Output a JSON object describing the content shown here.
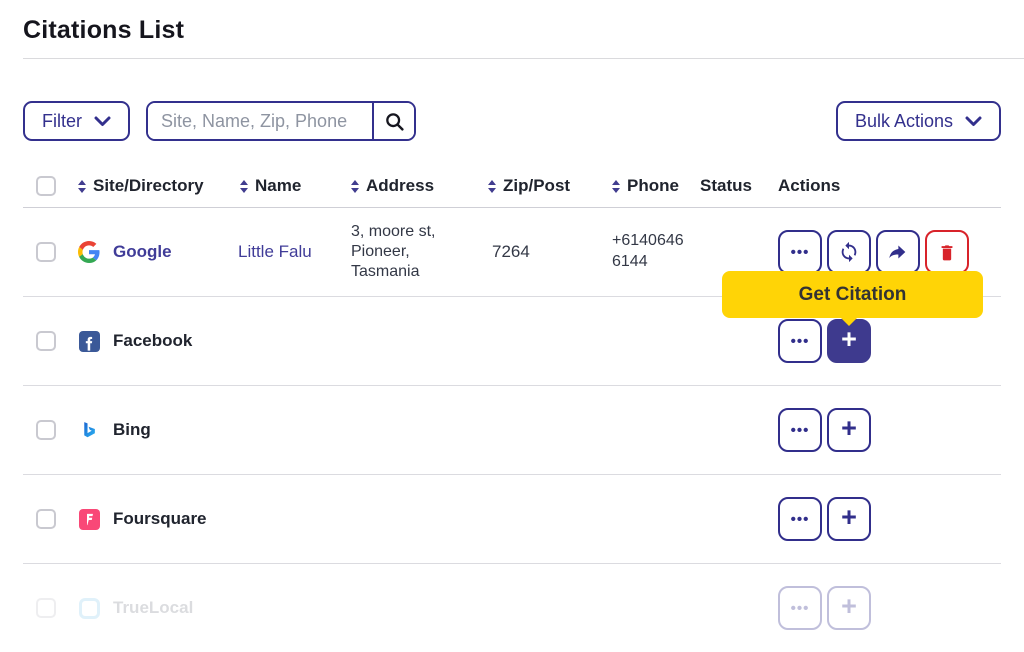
{
  "page": {
    "title": "Citations List"
  },
  "toolbar": {
    "filter_label": "Filter",
    "search_placeholder": "Site, Name, Zip, Phone",
    "bulk_actions_label": "Bulk Actions"
  },
  "table": {
    "headers": {
      "site": "Site/Directory",
      "name": "Name",
      "address": "Address",
      "zip": "Zip/Post",
      "phone": "Phone",
      "status": "Status",
      "actions": "Actions"
    },
    "rows": [
      {
        "site": "Google",
        "icon": "google-logo",
        "name": "Little Falu",
        "address": "3, moore st, Pioneer, Tasmania",
        "zip": "7264",
        "phone_line1": "+6140646",
        "phone_line2": "6144"
      },
      {
        "site": "Facebook",
        "icon": "facebook-logo"
      },
      {
        "site": "Bing",
        "icon": "bing-logo"
      },
      {
        "site": "Foursquare",
        "icon": "foursquare-logo"
      },
      {
        "site": "TrueLocal",
        "icon": "truelocal-logo"
      }
    ]
  },
  "tooltip": {
    "label": "Get Citation"
  },
  "icons": {
    "more": "•••",
    "plus": "+"
  },
  "colors": {
    "primary_indigo": "#312e8b",
    "filled_button_indigo": "#3e3a8e",
    "link_indigo": "#403c98",
    "danger_red": "#d8232a",
    "tooltip_yellow": "#ffd406",
    "facebook_blue": "#3b5998",
    "foursquare_pink": "#f94877",
    "truelocal_blue": "#9ad2ef"
  }
}
